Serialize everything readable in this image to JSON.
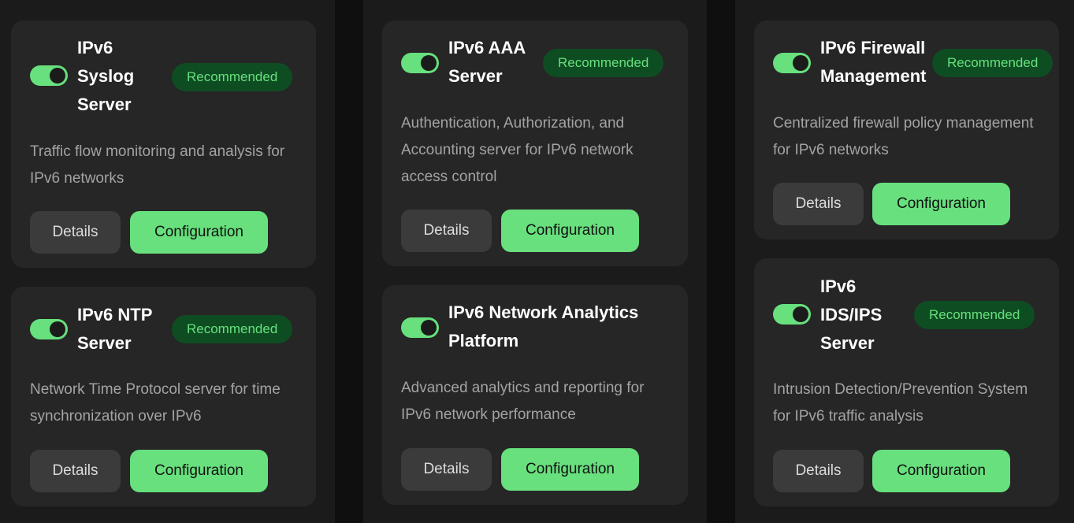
{
  "cards": [
    {
      "title": "IPv6 Syslog Server",
      "badge": "Recommended",
      "description": "Traffic flow monitoring and analysis for IPv6 networks",
      "details_label": "Details",
      "config_label": "Configuration"
    },
    {
      "title": "IPv6 NTP Server",
      "badge": "Recommended",
      "description": "Network Time Protocol server for time synchronization over IPv6",
      "details_label": "Details",
      "config_label": "Configuration"
    },
    {
      "title": "IPv6 AAA Server",
      "badge": "Recommended",
      "description": "Authentication, Authorization, and Accounting server for IPv6 network access control",
      "details_label": "Details",
      "config_label": "Configuration"
    },
    {
      "title": "IPv6 Network Analytics Platform",
      "description": "Advanced analytics and reporting for IPv6 network performance",
      "details_label": "Details",
      "config_label": "Configuration"
    },
    {
      "title": "IPv6 Firewall Management",
      "badge": "Recommended",
      "description": "Centralized firewall policy management for IPv6 networks",
      "details_label": "Details",
      "config_label": "Configuration"
    },
    {
      "title": "IPv6 IDS/IPS Server",
      "badge": "Recommended",
      "description": "Intrusion Detection/Prevention System for IPv6 traffic analysis",
      "details_label": "Details",
      "config_label": "Configuration"
    }
  ],
  "colors": {
    "accent": "#67e07d",
    "badge_bg": "#0e4d22",
    "card_bg": "#262626",
    "page_bg": "#0f0f0f"
  }
}
